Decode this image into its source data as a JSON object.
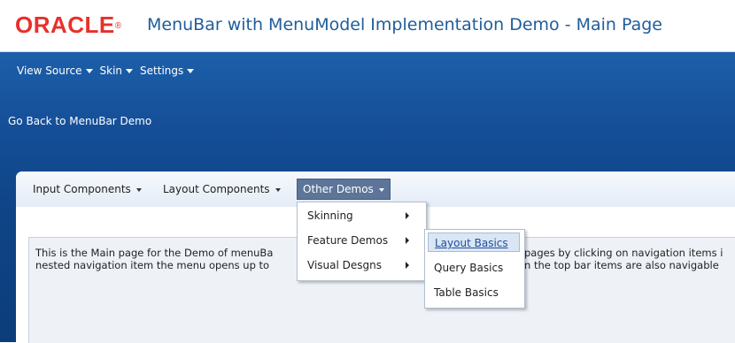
{
  "header": {
    "logo_text": "ORACLE",
    "logo_mark": "®",
    "title": "MenuBar with MenuModel Implementation Demo - Main Page"
  },
  "top_menu": [
    {
      "label": "View Source"
    },
    {
      "label": "Skin"
    },
    {
      "label": "Settings"
    }
  ],
  "back_link": "Go Back to MenuBar Demo",
  "menubar": {
    "items": [
      {
        "label": "Input Components"
      },
      {
        "label": "Layout Components"
      },
      {
        "label": "Other Demos"
      }
    ]
  },
  "submenu_other_demos": [
    {
      "label": "Skinning"
    },
    {
      "label": "Feature Demos"
    },
    {
      "label": "Visual Desgns"
    }
  ],
  "submenu_feature_demos": [
    {
      "label": "Layout Basics"
    },
    {
      "label": "Query Basics"
    },
    {
      "label": "Table Basics"
    }
  ],
  "content": {
    "line1_a": "This is the Main page for the Demo of menuBa",
    "line1_b": "pages by clicking on navigation items i",
    "line2_a": "nested navigation item the menu opens up to",
    "line2_b": "n the top bar items are also navigable"
  },
  "colors": {
    "oracle_red": "#e8302a",
    "title_blue": "#1f5d9b",
    "band_blue": "#0f4486",
    "selected_menu_bg": "#5c7599"
  }
}
